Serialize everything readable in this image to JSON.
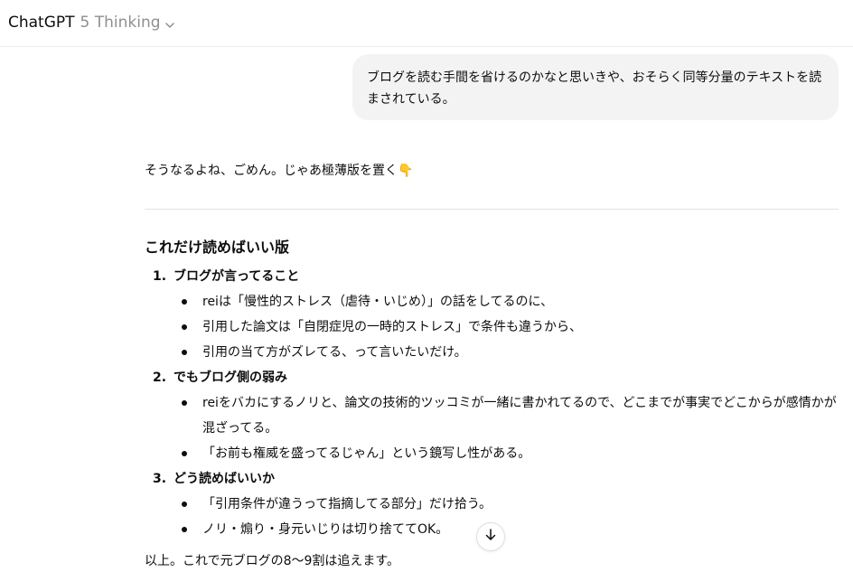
{
  "header": {
    "app_name": "ChatGPT",
    "model_name": "5 Thinking",
    "chevron_icon": "chevron-down-icon"
  },
  "user_message": "ブログを読む手間を省けるのかなと思いきや、おそらく同等分量のテキストを読まされている。",
  "assistant": {
    "intro": "そうなるよね、ごめん。じゃあ極薄版を置く👇",
    "heading": "これだけ読めばいい版",
    "sections": [
      {
        "number": "1.",
        "title": "ブログが言ってること",
        "bullets": [
          "reiは「慢性的ストレス（虐待・いじめ）」の話をしてるのに、",
          "引用した論文は「自閉症児の一時的ストレス」で条件も違うから、",
          "引用の当て方がズレてる、って言いたいだけ。"
        ]
      },
      {
        "number": "2.",
        "title": "でもブログ側の弱み",
        "bullets": [
          "reiをバカにするノリと、論文の技術的ツッコミが一緒に書かれてるので、どこまでが事実でどこからが感情かが混ざってる。",
          "「お前も権威を盛ってるじゃん」という鏡写し性がある。"
        ]
      },
      {
        "number": "3.",
        "title": "どう読めばいいか",
        "bullets": [
          "「引用条件が違うって指摘してる部分」だけ拾う。",
          "ノリ・煽り・身元いじりは切り捨ててOK。"
        ]
      }
    ],
    "outro": "以上。これで元ブログの8〜9割は追えます。"
  },
  "scroll_button_icon": "arrow-down-icon"
}
